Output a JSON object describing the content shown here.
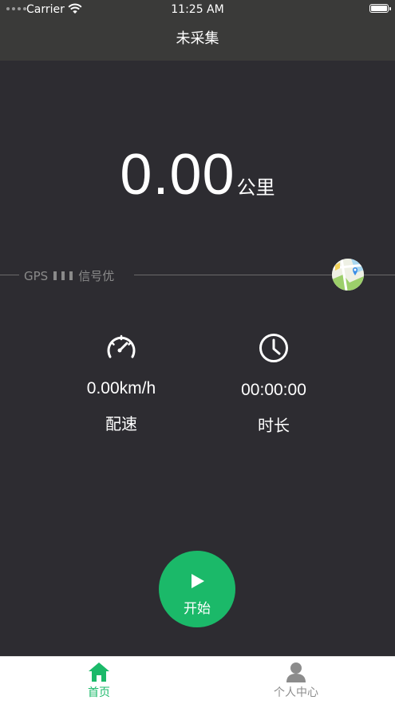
{
  "status_bar": {
    "carrier": "Carrier",
    "time": "11:25 AM"
  },
  "nav": {
    "title": "未采集"
  },
  "distance": {
    "value": "0.00",
    "unit": "公里"
  },
  "gps": {
    "prefix": "GPS",
    "signal_label": "信号优"
  },
  "metrics": {
    "speed": {
      "value": "0.00km/h",
      "label": "配速",
      "icon": "speedometer-icon"
    },
    "duration": {
      "value": "00:00:00",
      "label": "时长",
      "icon": "clock-icon"
    }
  },
  "start_button": {
    "label": "开始",
    "icon": "play-icon"
  },
  "tabs": [
    {
      "label": "首页",
      "icon": "home-icon",
      "active": true
    },
    {
      "label": "个人中心",
      "icon": "user-icon",
      "active": false
    }
  ],
  "colors": {
    "background": "#2d2c31",
    "nav_background": "#3a3a39",
    "accent_green": "#1bb969",
    "muted_text": "#8a8a8a"
  }
}
